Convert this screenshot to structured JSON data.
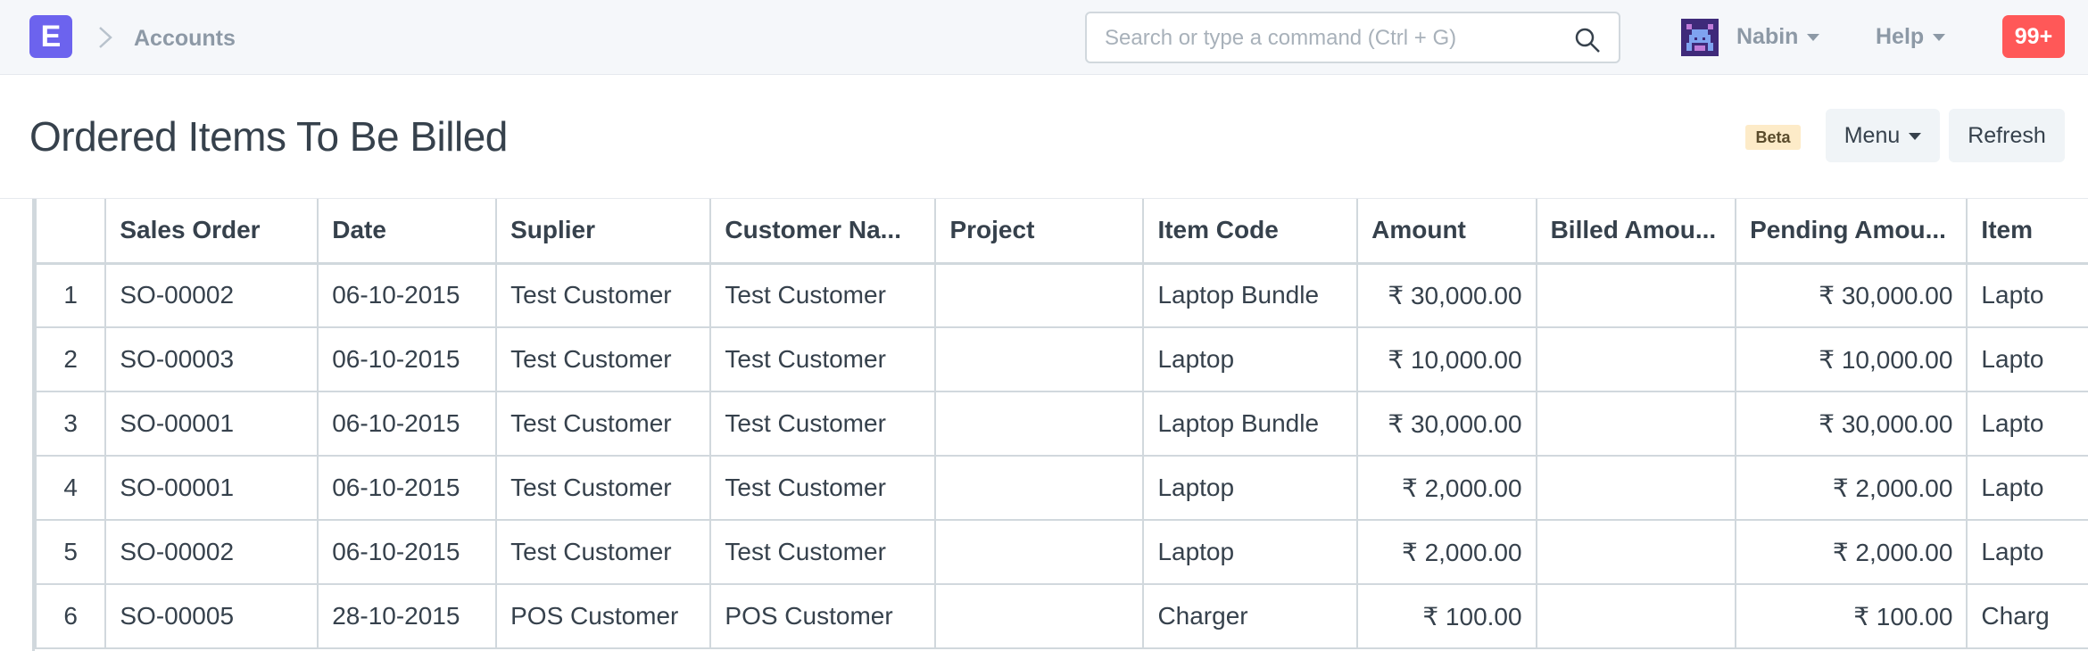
{
  "navbar": {
    "logo_letter": "E",
    "breadcrumb": "Accounts",
    "search_placeholder": "Search or type a command (Ctrl + G)",
    "user": "Nabin",
    "help": "Help",
    "notifications": "99+"
  },
  "page": {
    "title": "Ordered Items To Be Billed",
    "badge": "Beta",
    "menu_label": "Menu",
    "refresh_label": "Refresh"
  },
  "table": {
    "columns": [
      "",
      "Sales Order",
      "Date",
      "Suplier",
      "Customer Na...",
      "Project",
      "Item Code",
      "Amount",
      "Billed Amou...",
      "Pending Amou...",
      "Item"
    ],
    "rows": [
      [
        "1",
        "SO-00002",
        "06-10-2015",
        "Test Customer",
        "Test Customer",
        "",
        "Laptop Bundle",
        "₹ 30,000.00",
        "",
        "₹ 30,000.00",
        "Lapto"
      ],
      [
        "2",
        "SO-00003",
        "06-10-2015",
        "Test Customer",
        "Test Customer",
        "",
        "Laptop",
        "₹ 10,000.00",
        "",
        "₹ 10,000.00",
        "Lapto"
      ],
      [
        "3",
        "SO-00001",
        "06-10-2015",
        "Test Customer",
        "Test Customer",
        "",
        "Laptop Bundle",
        "₹ 30,000.00",
        "",
        "₹ 30,000.00",
        "Lapto"
      ],
      [
        "4",
        "SO-00001",
        "06-10-2015",
        "Test Customer",
        "Test Customer",
        "",
        "Laptop",
        "₹ 2,000.00",
        "",
        "₹ 2,000.00",
        "Lapto"
      ],
      [
        "5",
        "SO-00002",
        "06-10-2015",
        "Test Customer",
        "Test Customer",
        "",
        "Laptop",
        "₹ 2,000.00",
        "",
        "₹ 2,000.00",
        "Lapto"
      ],
      [
        "6",
        "SO-00005",
        "28-10-2015",
        "POS Customer",
        "POS Customer",
        "",
        "Charger",
        "₹ 100.00",
        "",
        "₹ 100.00",
        "Charg"
      ]
    ]
  },
  "colors": {
    "logo": "#6c63ee",
    "notification": "#ff5858",
    "beta_badge": "#fdebc8",
    "border": "#d1d8dd"
  },
  "icons": [
    "chevron-right-icon",
    "search-icon",
    "avatar-icon",
    "caret-down-icon"
  ]
}
